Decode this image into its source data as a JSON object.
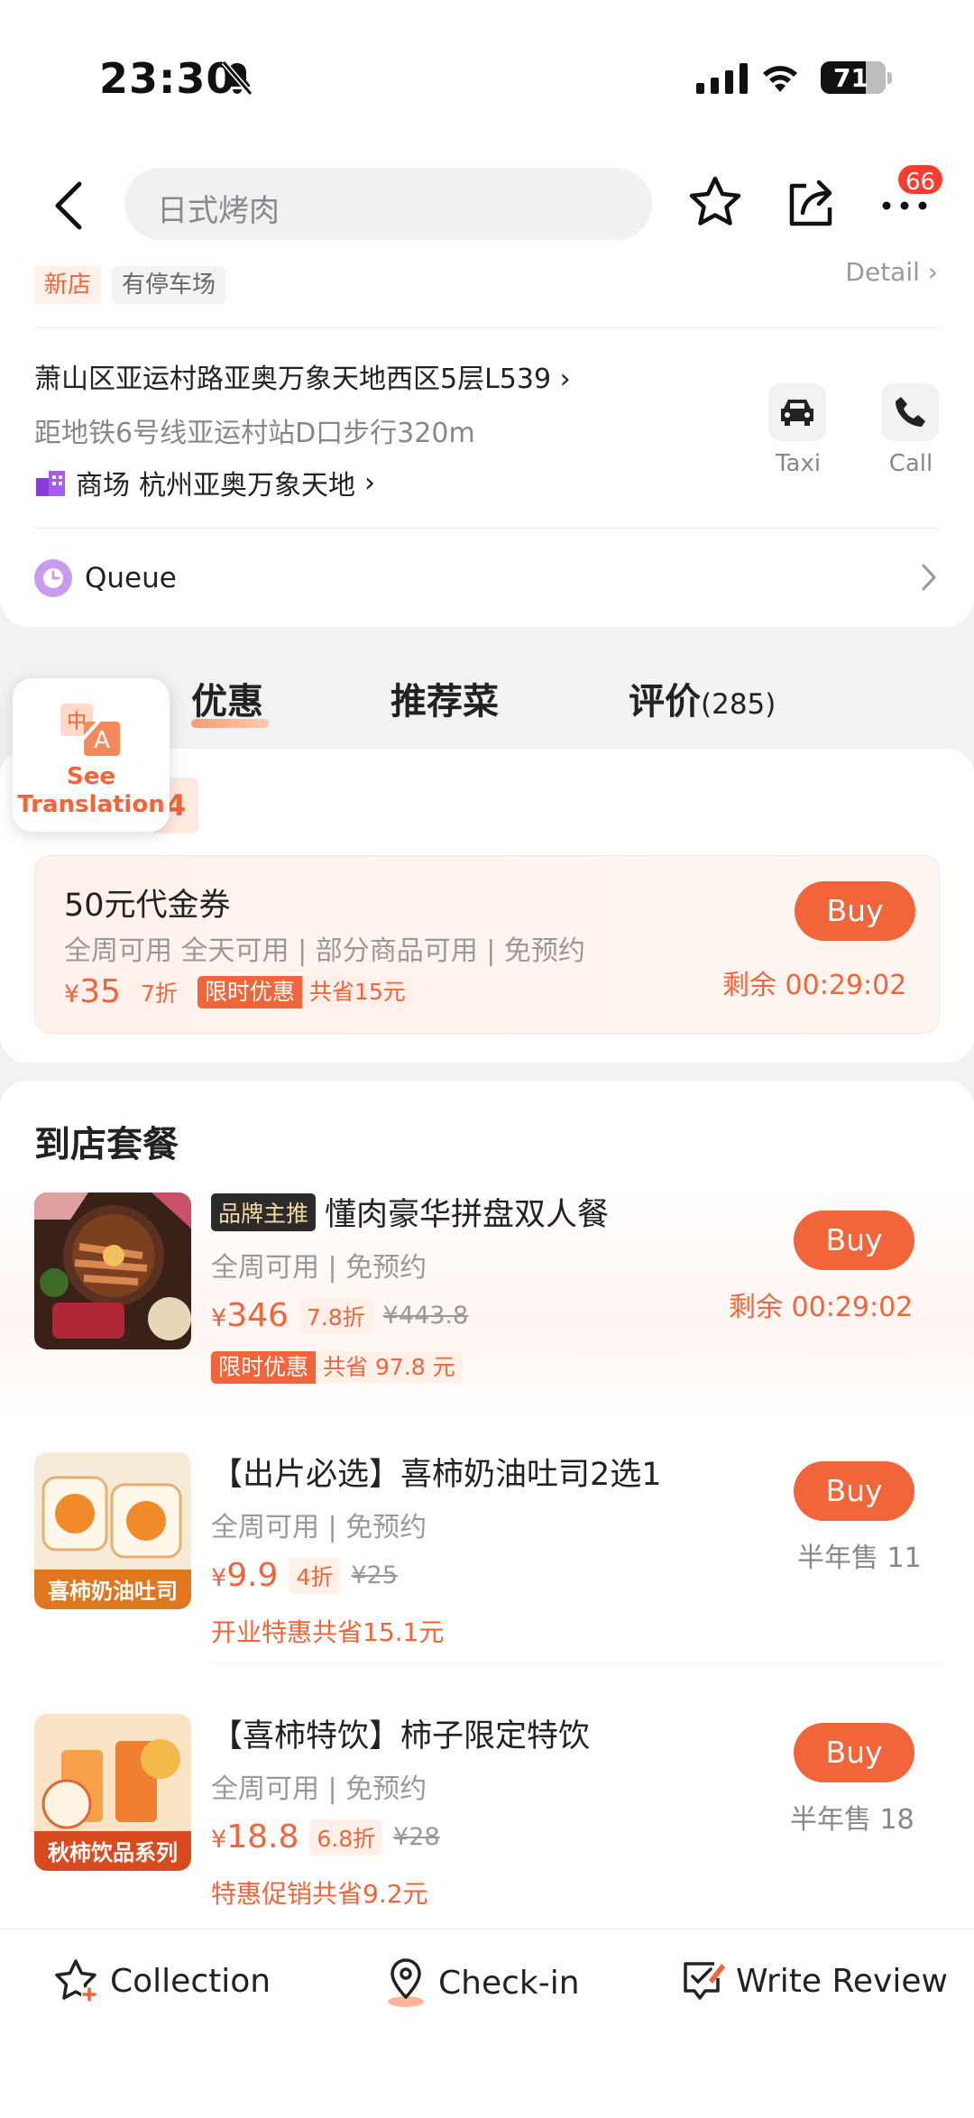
{
  "status": {
    "time": "23:30",
    "battery": "71"
  },
  "nav": {
    "search_text": "日式烤肉",
    "badge": "66"
  },
  "info": {
    "tags": [
      "新店",
      "有停车场"
    ],
    "detail_label": "Detail",
    "address": "萧山区亚运村路亚奥万象天地西区5层L539",
    "metro": "距地铁6号线亚运村站D口步行320m",
    "mall_label": "商场",
    "mall_name": "杭州亚奥万象天地",
    "taxi_label": "Taxi",
    "call_label": "Call",
    "queue_label": "Queue"
  },
  "tabs": [
    {
      "label": "优惠",
      "active": true
    },
    {
      "label": "推荐菜"
    },
    {
      "label": "评价",
      "count": "(285)"
    }
  ],
  "translation": {
    "line1": "See",
    "line2": "Translation"
  },
  "deal_section": {
    "count": "4",
    "deal": {
      "title": "50元代金券",
      "tags": "全周可用 全天可用 | 部分商品可用 | 免预约",
      "currency": "¥",
      "price": "35",
      "discount": "7折",
      "limit_label": "限时优惠",
      "save_label": "共省15元",
      "buy_label": "Buy",
      "countdown": "剩余 00:29:02"
    }
  },
  "meals": {
    "title": "到店套餐",
    "items": [
      {
        "brand_tag": "品牌主推",
        "name": "懂肉豪华拼盘双人餐",
        "tags": "全周可用 | 免预约",
        "currency": "¥",
        "price": "346",
        "discount": "7.8折",
        "original": "¥443.8",
        "extra_a": "限时优惠",
        "extra_b": "共省 97.8 元",
        "buy_label": "Buy",
        "status": "剩余 00:29:02"
      },
      {
        "name": "【出片必选】喜柿奶油吐司2选1",
        "tags": "全周可用 | 免预约",
        "currency": "¥",
        "price": "9.9",
        "discount": "4折",
        "original": "¥25",
        "extra": "开业特惠共省15.1元",
        "buy_label": "Buy",
        "status": "半年售 11",
        "thumb_text": "喜柿奶油吐司"
      },
      {
        "name": "【喜柿特饮】柿子限定特饮",
        "tags": "全周可用 | 免预约",
        "currency": "¥",
        "price": "18.8",
        "discount": "6.8折",
        "original": "¥28",
        "extra": "特惠促销共省9.2元",
        "buy_label": "Buy",
        "status": "半年售 18",
        "thumb_text": "秋柿饮品系列"
      }
    ]
  },
  "bottom": {
    "collection": "Collection",
    "checkin": "Check-in",
    "review": "Write Review"
  }
}
